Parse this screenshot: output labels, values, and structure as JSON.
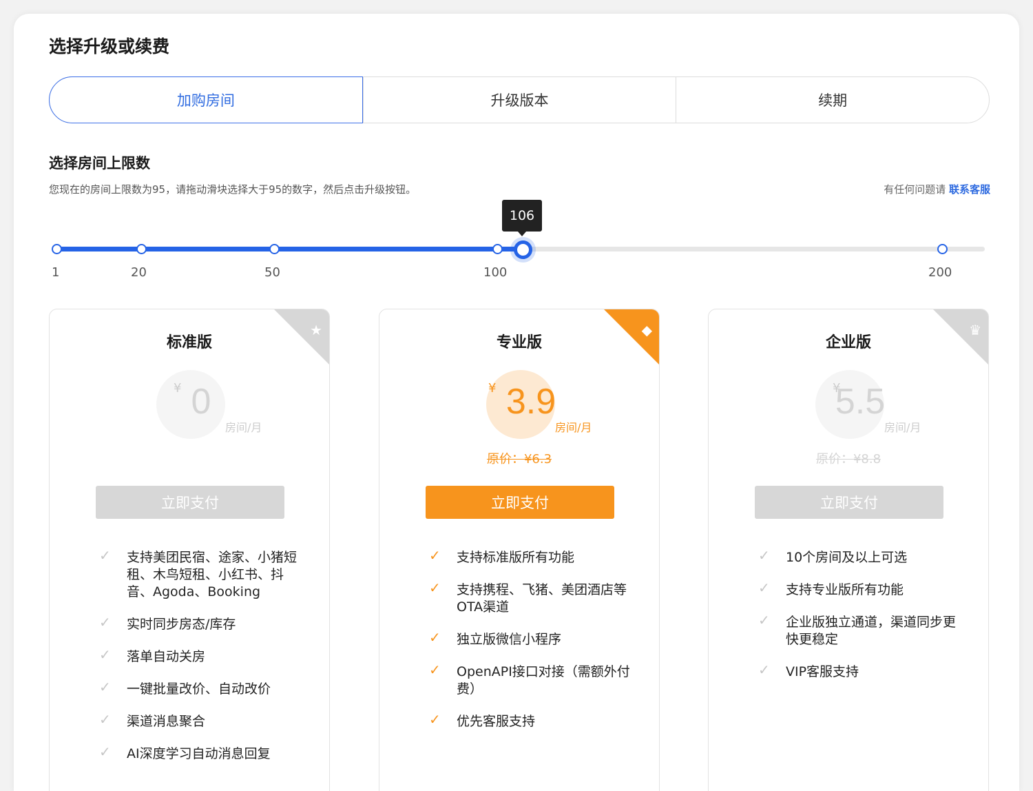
{
  "title": "选择升级或续费",
  "tabs": [
    {
      "label": "加购房间",
      "active": true
    },
    {
      "label": "升级版本",
      "active": false
    },
    {
      "label": "续期",
      "active": false
    }
  ],
  "section": {
    "title": "选择房间上限数",
    "hint": "您现在的房间上限数为95，请拖动滑块选择大于95的数字，然后点击升级按钮。",
    "help_prefix": "有任何问题请",
    "help_link": "联系客服"
  },
  "slider": {
    "value": "106",
    "ticks": [
      "1",
      "20",
      "50",
      "100",
      "200"
    ],
    "accent": "#2563e6"
  },
  "plans": [
    {
      "title": "标准版",
      "corner_icon": "star-icon",
      "currency": "¥",
      "price": "0",
      "unit": "房间/月",
      "original": "",
      "button": "立即支付",
      "features": [
        "支持美团民宿、途家、小猪短租、木鸟短租、小红书、抖音、Agoda、Booking",
        "实时同步房态/库存",
        "落单自动关房",
        "一键批量改价、自动改价",
        "渠道消息聚合",
        "AI深度学习自动消息回复"
      ]
    },
    {
      "title": "专业版",
      "corner_icon": "diamond-icon",
      "currency": "¥",
      "price": "3.9",
      "unit": "房间/月",
      "original": "原价：¥6.3",
      "button": "立即支付",
      "features": [
        "支持标准版所有功能",
        "支持携程、飞猪、美团酒店等OTA渠道",
        "独立版微信小程序",
        "OpenAPI接口对接（需额外付费）",
        "优先客服支持"
      ]
    },
    {
      "title": "企业版",
      "corner_icon": "crown-icon",
      "currency": "¥",
      "price": "5.5",
      "unit": "房间/月",
      "original": "原价：¥8.8",
      "button": "立即支付",
      "features": [
        "10个房间及以上可选",
        "支持专业版所有功能",
        "企业版独立通道，渠道同步更快更稳定",
        "VIP客服支持"
      ]
    }
  ],
  "colors": {
    "orange": "#f7941d",
    "blue": "#2f6be0",
    "gray": "#d7d7d7"
  }
}
